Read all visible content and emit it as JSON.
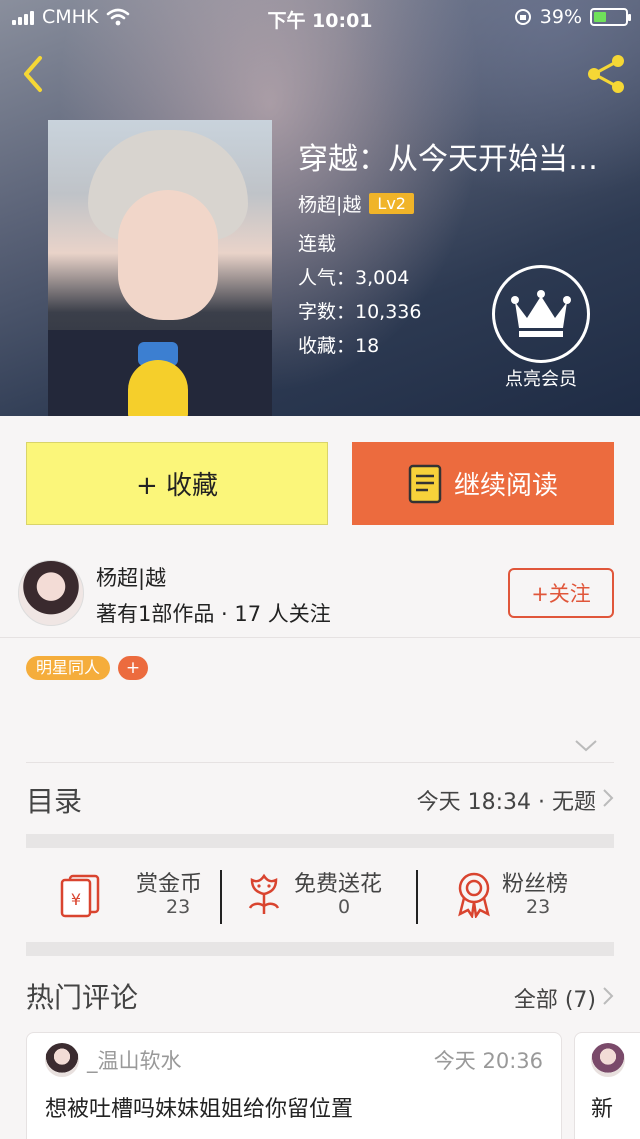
{
  "status_bar": {
    "carrier": "CMHK",
    "time": "下午 10:01",
    "battery": "39%",
    "battery_level": 0.39
  },
  "book": {
    "title": "穿越：从今天开始当…",
    "author": "杨超|越",
    "level": "Lv2",
    "status": "连载",
    "popularity_label": "人气：3,004",
    "words_label": "字数：10,336",
    "favorites_label": "收藏：18"
  },
  "vip": {
    "label": "点亮会员"
  },
  "actions": {
    "collect_label": "+ 收藏",
    "read_label": "继续阅读"
  },
  "author_card": {
    "name": "杨超|越",
    "subtitle": "著有1部作品 · 17 人关注",
    "follow_label": "+关注"
  },
  "tags": [
    "明星同人"
  ],
  "tag_add_label": "+",
  "toc": {
    "title": "目录",
    "latest": "今天 18:34 · 无题"
  },
  "stats": [
    {
      "label": "赏金币",
      "value": "23"
    },
    {
      "label": "免费送花",
      "value": "0"
    },
    {
      "label": "粉丝榜",
      "value": "23"
    }
  ],
  "hot_comments": {
    "title": "热门评论",
    "all_label": "全部 (7)",
    "items": [
      {
        "user": "_温山软水",
        "time": "今天 20:36",
        "text": "想被吐槽吗妹妹姐姐给你留位置"
      },
      {
        "text": "新"
      }
    ]
  },
  "colors": {
    "accent_orange": "#ec6b3e",
    "collect_yellow": "#fbf67a",
    "tag_orange": "#f5ad3b",
    "level_gold": "#f0b429"
  }
}
